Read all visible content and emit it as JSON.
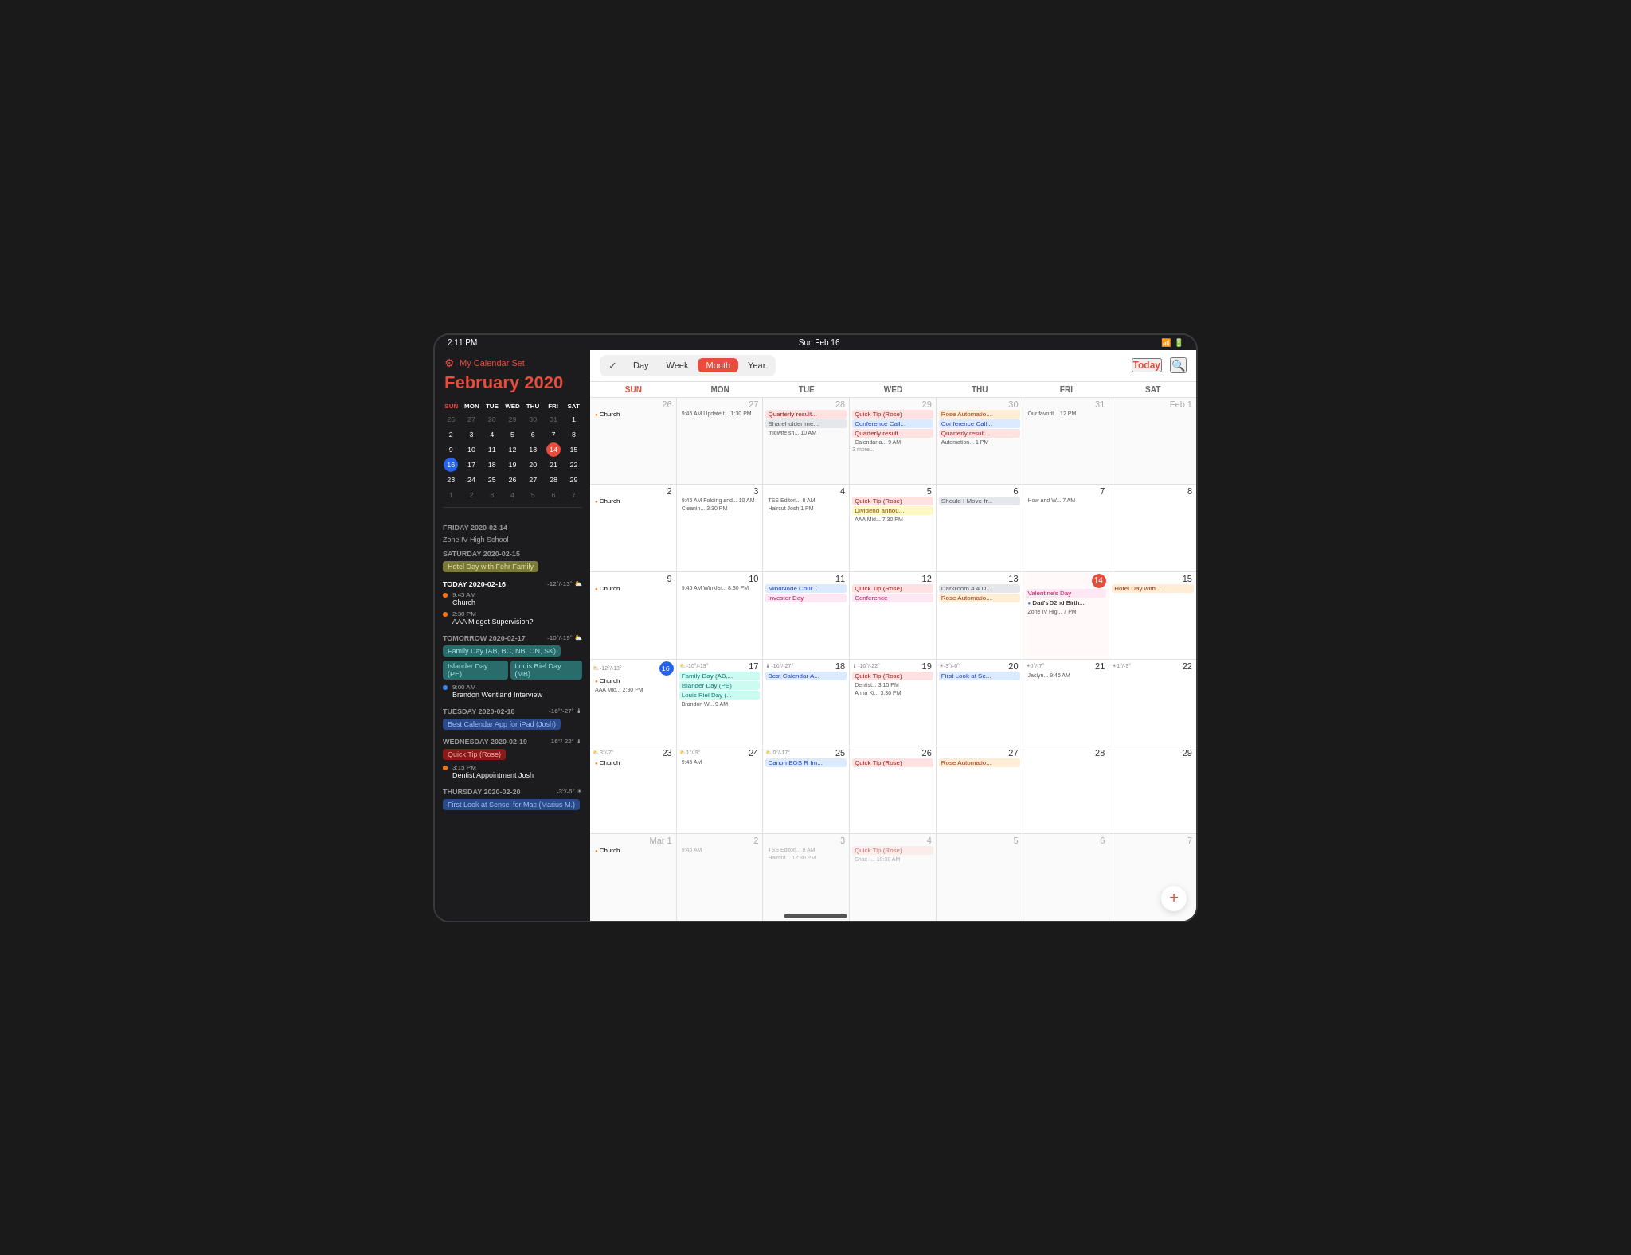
{
  "statusBar": {
    "time": "2:11 PM",
    "date": "Sun Feb 16",
    "wifi": "wifi",
    "battery": "battery"
  },
  "sidebar": {
    "settingsLabel": "My Calendar Set",
    "monthTitle": "February",
    "yearTitle": "2020",
    "miniCal": {
      "dayHeaders": [
        "SUN",
        "MON",
        "TUE",
        "WED",
        "THU",
        "FRI",
        "SAT"
      ],
      "weeks": [
        [
          {
            "n": "26",
            "p": true
          },
          {
            "n": "27",
            "p": true
          },
          {
            "n": "28",
            "p": true
          },
          {
            "n": "29",
            "p": true
          },
          {
            "n": "30",
            "p": true
          },
          {
            "n": "31",
            "p": true
          },
          {
            "n": "1"
          }
        ],
        [
          {
            "n": "2"
          },
          {
            "n": "3"
          },
          {
            "n": "4"
          },
          {
            "n": "5"
          },
          {
            "n": "6"
          },
          {
            "n": "7"
          },
          {
            "n": "8"
          }
        ],
        [
          {
            "n": "9"
          },
          {
            "n": "10"
          },
          {
            "n": "11"
          },
          {
            "n": "12"
          },
          {
            "n": "13"
          },
          {
            "n": "14",
            "today": true
          }
        ],
        [
          {
            "n": "15"
          },
          {
            "n": "16",
            "circle": true
          },
          {
            "n": "17"
          },
          {
            "n": "18"
          },
          {
            "n": "19"
          },
          {
            "n": "20"
          },
          {
            "n": "21"
          },
          {
            "n": "22"
          }
        ],
        [
          {
            "n": "23"
          },
          {
            "n": "24"
          },
          {
            "n": "25"
          },
          {
            "n": "26"
          },
          {
            "n": "27"
          },
          {
            "n": "28"
          },
          {
            "n": "29"
          }
        ],
        [
          {
            "n": "1",
            "p2": true
          },
          {
            "n": "2",
            "p2": true
          },
          {
            "n": "3",
            "p2": true
          },
          {
            "n": "4",
            "p2": true
          },
          {
            "n": "5",
            "p2": true
          },
          {
            "n": "6",
            "p2": true
          },
          {
            "n": "7",
            "p2": true
          }
        ]
      ]
    },
    "events": [
      {
        "type": "dayHeader",
        "label": "FRIDAY 2020-02-14"
      },
      {
        "type": "text",
        "text": "Zone IV High School"
      },
      {
        "type": "dayHeader",
        "label": "SATURDAY 2020-02-15"
      },
      {
        "type": "tag",
        "label": "Hotel Day with Fehr Family",
        "cls": "tag-olive"
      },
      {
        "type": "todayHeader",
        "label": "TODAY 2020-02-16",
        "weather": "-12°/-13° ⛅"
      },
      {
        "type": "timeEvent",
        "time": "9:45 AM",
        "name": "Church",
        "dot": "orange"
      },
      {
        "type": "timeEvent",
        "time": "2:30 PM",
        "name": "AAA Midget Supervision?",
        "dot": "orange"
      },
      {
        "type": "dayHeader2",
        "label": "TOMORROW 2020-02-17",
        "weather": "-10°/-19° ⛅"
      },
      {
        "type": "tag",
        "label": "Family Day (AB, BC, NB, ON, SK)",
        "cls": "tag-teal"
      },
      {
        "type": "tagRow",
        "tags": [
          {
            "label": "Islander Day (PE)",
            "cls": "tag-teal"
          },
          {
            "label": "Louis Riel Day (MB)",
            "cls": "tag-teal"
          }
        ]
      },
      {
        "type": "timeEvent",
        "time": "9:00 AM",
        "name": "Brandon Wentland Interview",
        "dot": "blue"
      },
      {
        "type": "dayHeader2",
        "label": "TUESDAY 2020-02-18",
        "weather": "-16°/-27° 🌡"
      },
      {
        "type": "tag",
        "label": "Best Calendar App for iPad (Josh)",
        "cls": "tag-blue"
      },
      {
        "type": "dayHeader2",
        "label": "WEDNESDAY 2020-02-19",
        "weather": "-16°/-22° 🌡"
      },
      {
        "type": "tag",
        "label": "Quick Tip (Rose)",
        "cls": "tag-red"
      },
      {
        "type": "timeEvent",
        "time": "3:15 PM",
        "name": "Dentist Appointment Josh",
        "dot": "orange"
      },
      {
        "type": "dayHeader2",
        "label": "THURSDAY 2020-02-20",
        "weather": "-3°/-6° ☀"
      },
      {
        "type": "tag",
        "label": "First Look at Sensei for Mac (Marius M.)",
        "cls": "tag-blue"
      }
    ]
  },
  "calendar": {
    "toolbar": {
      "checkLabel": "✓",
      "dayLabel": "Day",
      "weekLabel": "Week",
      "monthLabel": "Month",
      "yearLabel": "Year",
      "todayLabel": "Today",
      "searchLabel": "🔍"
    },
    "colHeaders": [
      "SUN",
      "MON",
      "TUE",
      "WED",
      "THU",
      "FRI",
      "SAT"
    ],
    "rows": [
      {
        "cells": [
          {
            "day": "26",
            "other": true,
            "events": [
              {
                "text": "Church",
                "dot": "orange"
              }
            ]
          },
          {
            "day": "27",
            "other": true,
            "events": [
              {
                "text": "9:45 AM Update t... 1:30 PM",
                "plain": true
              }
            ]
          },
          {
            "day": "28",
            "other": true,
            "events": [
              {
                "text": "Quarterly result...",
                "cls": "ev-red"
              },
              {
                "text": "Shareholder me...",
                "cls": "ev-gray"
              },
              {
                "text": "midwife sh... 10 AM",
                "plain": true
              }
            ]
          },
          {
            "day": "29",
            "other": true,
            "events": [
              {
                "text": "Quick Tip (Rose)",
                "cls": "ev-red"
              },
              {
                "text": "Conference Call...",
                "cls": "ev-blue"
              },
              {
                "text": "Quarterly result...",
                "cls": "ev-red"
              },
              {
                "text": "Calendar a... 9 AM",
                "plain": true
              },
              {
                "text": "3 more...",
                "more": true
              }
            ]
          },
          {
            "day": "30",
            "other": true,
            "events": [
              {
                "text": "Rose Automatio...",
                "cls": "ev-orange"
              },
              {
                "text": "Conference Call...",
                "cls": "ev-blue"
              },
              {
                "text": "Quarterly result...",
                "cls": "ev-red"
              },
              {
                "text": "Automation... 1 PM",
                "plain": true
              }
            ]
          },
          {
            "day": "31",
            "other": true,
            "events": [
              {
                "text": "Our favorit... 12 PM",
                "plain": true
              }
            ]
          },
          {
            "day": "Feb 1",
            "other": true,
            "events": []
          }
        ]
      },
      {
        "cells": [
          {
            "day": "2",
            "events": [
              {
                "text": "Church",
                "dot": "orange"
              }
            ]
          },
          {
            "day": "3",
            "events": [
              {
                "text": "9:45 AM Folding and... 10 AM",
                "plain": true
              },
              {
                "text": "Cleanin... 3:30 PM",
                "plain": true
              }
            ]
          },
          {
            "day": "4",
            "events": [
              {
                "text": "TSS Editori... 8 AM",
                "plain": true
              },
              {
                "text": "Haircut Josh 1 PM",
                "plain": true
              }
            ]
          },
          {
            "day": "5",
            "events": [
              {
                "text": "Quick Tip (Rose)",
                "cls": "ev-red"
              },
              {
                "text": "Dividend annou...",
                "cls": "ev-yellow"
              },
              {
                "text": "AAA Mid... 7:30 PM",
                "plain": true
              }
            ]
          },
          {
            "day": "6",
            "events": [
              {
                "text": "Should I Move fr...",
                "cls": "ev-gray"
              }
            ]
          },
          {
            "day": "7",
            "events": [
              {
                "text": "How and W... 7 AM",
                "plain": true
              }
            ]
          },
          {
            "day": "8",
            "events": []
          }
        ]
      },
      {
        "cells": [
          {
            "day": "9",
            "events": [
              {
                "text": "Church",
                "dot": "orange"
              }
            ]
          },
          {
            "day": "10",
            "events": [
              {
                "text": "9:45 AM Winkler... 8:30 PM",
                "plain": true
              }
            ]
          },
          {
            "day": "11",
            "events": [
              {
                "text": "MindNode Cour...",
                "cls": "ev-blue"
              },
              {
                "text": "Investor Day",
                "cls": "ev-pink"
              }
            ]
          },
          {
            "day": "12",
            "events": [
              {
                "text": "Quick Tip (Rose)",
                "cls": "ev-red"
              },
              {
                "text": "Conference",
                "cls": "ev-pink"
              }
            ]
          },
          {
            "day": "13",
            "events": [
              {
                "text": "Darkroom 4.4 U...",
                "cls": "ev-gray"
              },
              {
                "text": "Rose Automatio...",
                "cls": "ev-orange"
              }
            ]
          },
          {
            "day": "14",
            "today": true,
            "events": [
              {
                "text": "Valentine's Day",
                "cls": "ev-pink"
              },
              {
                "text": "Dad's 52nd Birth...",
                "dot": "blue"
              },
              {
                "text": "Zone IV Hig... 7 PM",
                "plain": true
              }
            ]
          },
          {
            "day": "15",
            "events": [
              {
                "text": "Hotel Day with...",
                "cls": "ev-orange"
              }
            ]
          }
        ]
      },
      {
        "cells": [
          {
            "day": "16",
            "circleNum": true,
            "events": [
              {
                "text": "Church",
                "dot": "orange"
              },
              {
                "text": "AAA Mid... 2:30 PM",
                "plain": true
              }
            ],
            "weather": "-12°/-13°"
          },
          {
            "day": "17",
            "events": [
              {
                "text": "Family Day (AB,...",
                "cls": "ev-teal"
              },
              {
                "text": "Islander Day (PE)",
                "cls": "ev-teal"
              },
              {
                "text": "Louis Riel Day (...",
                "cls": "ev-teal"
              },
              {
                "text": "Brandon W... 9 AM",
                "plain": true
              }
            ],
            "weather": "-10°/-19°"
          },
          {
            "day": "18",
            "events": [
              {
                "text": "Best Calendar A...",
                "cls": "ev-blue"
              }
            ],
            "weather": "-16°/-27°"
          },
          {
            "day": "19",
            "events": [
              {
                "text": "Quick Tip (Rose)",
                "cls": "ev-red"
              },
              {
                "text": "Dentist... 3:15 PM",
                "plain": true
              },
              {
                "text": "Anna Ki... 3:30 PM",
                "plain": true
              }
            ],
            "weather": "-16°/-22°"
          },
          {
            "day": "20",
            "events": [
              {
                "text": "First Look at Se...",
                "cls": "ev-blue"
              }
            ],
            "weather": "-3°/-6°"
          },
          {
            "day": "21",
            "events": [
              {
                "text": "Jaclyn... 9:45 AM",
                "plain": true
              }
            ],
            "weather": "0°/-7°"
          },
          {
            "day": "22",
            "events": [],
            "weather": "1°/-9°"
          }
        ]
      },
      {
        "cells": [
          {
            "day": "23",
            "events": [
              {
                "text": "Church",
                "dot": "orange"
              }
            ],
            "weather": "3°/-7°"
          },
          {
            "day": "24",
            "events": [
              {
                "text": "9:45 AM",
                "plain": true
              }
            ],
            "weather": "1°/-9°"
          },
          {
            "day": "25",
            "events": [
              {
                "text": "Canon EOS R Im...",
                "cls": "ev-blue"
              }
            ],
            "weather": "0°/-17°"
          },
          {
            "day": "26",
            "events": [
              {
                "text": "Quick Tip (Rose)",
                "cls": "ev-red"
              }
            ]
          },
          {
            "day": "27",
            "events": [
              {
                "text": "Rose Automatio...",
                "cls": "ev-orange"
              }
            ]
          },
          {
            "day": "28",
            "events": []
          },
          {
            "day": "29",
            "events": []
          }
        ]
      },
      {
        "cells": [
          {
            "day": "Mar 1",
            "other": true,
            "events": [
              {
                "text": "Church",
                "dot": "orange"
              }
            ]
          },
          {
            "day": "2",
            "other": true,
            "events": [
              {
                "text": "9:45 AM",
                "plain": true
              }
            ]
          },
          {
            "day": "3",
            "other": true,
            "events": [
              {
                "text": "TSS Editori... 8 AM",
                "plain": true
              },
              {
                "text": "Haircut... 12:30 PM",
                "plain": true
              }
            ]
          },
          {
            "day": "4",
            "other": true,
            "events": [
              {
                "text": "Quick Tip (Rose)",
                "cls": "ev-red"
              },
              {
                "text": "Shae i... 10:30 AM",
                "plain": true
              }
            ]
          },
          {
            "day": "5",
            "other": true,
            "events": []
          },
          {
            "day": "6",
            "other": true,
            "events": []
          },
          {
            "day": "7",
            "other": true,
            "events": []
          }
        ]
      }
    ],
    "fabLabel": "+"
  }
}
